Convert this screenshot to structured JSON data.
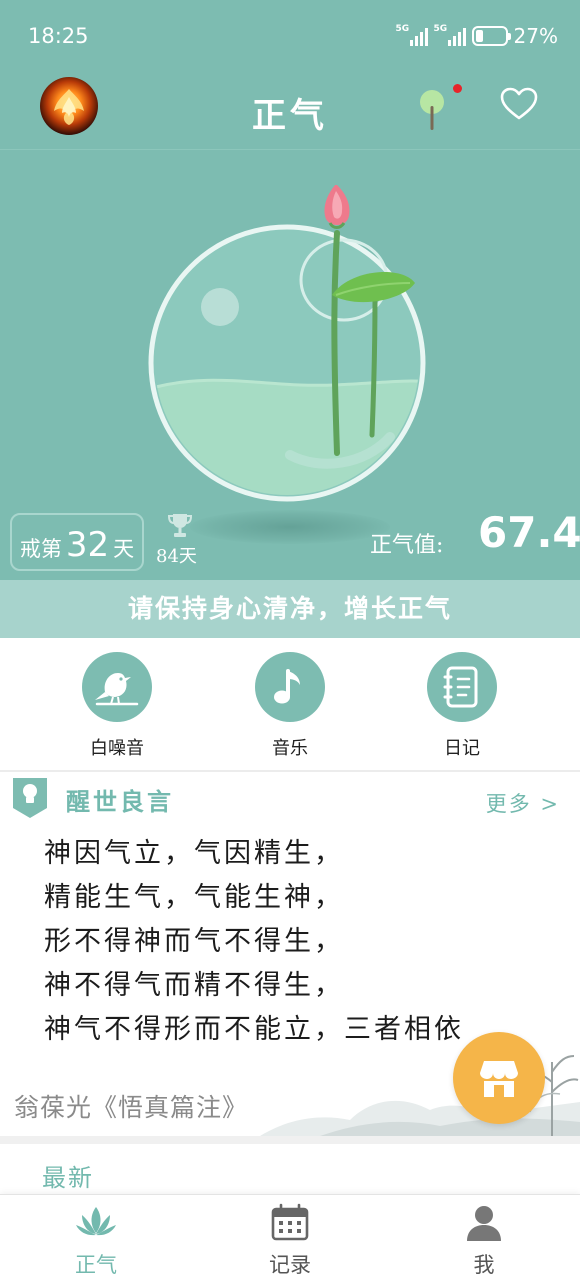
{
  "status_bar": {
    "time": "18:25",
    "sim1_label": "5G",
    "sim2_label": "5G",
    "battery_text": "27%",
    "battery_level": 0.27
  },
  "header": {
    "title": "正气",
    "notification_dot_color": "#e7242a"
  },
  "hero": {
    "days_prefix": "戒第",
    "days_count": "32",
    "days_suffix": "天",
    "record_days": "84天",
    "zhengqi_label": "正气值:",
    "zhengqi_value": "67.4"
  },
  "slogan": "请保持身心清净，增长正气",
  "quick_actions": [
    {
      "label": "白噪音",
      "icon": "bird-icon"
    },
    {
      "label": "音乐",
      "icon": "music-note-icon"
    },
    {
      "label": "日记",
      "icon": "notebook-icon"
    }
  ],
  "quote": {
    "section_title": "醒世良言",
    "more_label": "更多 >",
    "lines": [
      "神因气立，气因精生，",
      "精能生气，气能生神，",
      "形不得神而气不得生，",
      "神不得气而精不得生，",
      "神气不得形而不能立，三者相依"
    ],
    "source": "翁葆光《悟真篇注》"
  },
  "latest": {
    "title": "最新"
  },
  "tabbar": {
    "items": [
      {
        "label": "正气",
        "active": true
      },
      {
        "label": "记录",
        "active": false
      },
      {
        "label": "我",
        "active": false
      }
    ],
    "active_color": "#73b9ae",
    "inactive_color": "#555555"
  },
  "colors": {
    "primary": "#7dbcb1",
    "slogan_bg": "#a7d3cc",
    "fab": "#f5b549"
  }
}
